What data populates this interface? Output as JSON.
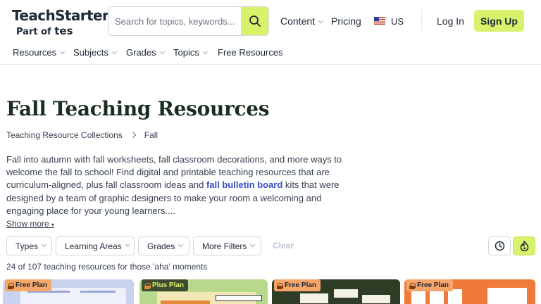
{
  "header": {
    "logo": {
      "name": "TeachStarter",
      "sub_prefix": "Part of",
      "sub_brand": "tes"
    },
    "search": {
      "placeholder": "Search for topics, keywords...",
      "icon": "search-icon"
    },
    "nav": {
      "content": "Content",
      "pricing": "Pricing",
      "region": "US",
      "login": "Log In",
      "signup": "Sign Up"
    },
    "subnav": [
      "Resources",
      "Subjects",
      "Grades",
      "Topics",
      "Free Resources"
    ],
    "accent": "#d7f26b"
  },
  "page": {
    "title": "Fall Teaching Resources",
    "breadcrumb": [
      "Teaching Resource Collections",
      "Fall"
    ],
    "description_before": "Fall into autumn with fall worksheets, fall classroom decorations, and more ways to welcome the fall to school! Find digital and printable teaching resources that are curriculum-aligned, plus fall classroom ideas and ",
    "description_link": "fall bulletin board",
    "description_after": " kits that were designed by a team of graphic designers to make your room a welcoming and engaging place for your young learners....",
    "show_more": "Show more"
  },
  "filters": {
    "types": "Types",
    "learning_areas": "Learning Areas",
    "grades": "Grades",
    "more": "More Filters",
    "clear": "Clear"
  },
  "results": {
    "count_text": "24 of 107 teaching resources for those 'aha' moments"
  },
  "cards": [
    {
      "badge": "Free Plan",
      "plan": "free"
    },
    {
      "badge": "Plus Plan",
      "plan": "plus"
    },
    {
      "badge": "Free Plan",
      "plan": "free"
    },
    {
      "badge": "Free Plan",
      "plan": "free"
    }
  ]
}
